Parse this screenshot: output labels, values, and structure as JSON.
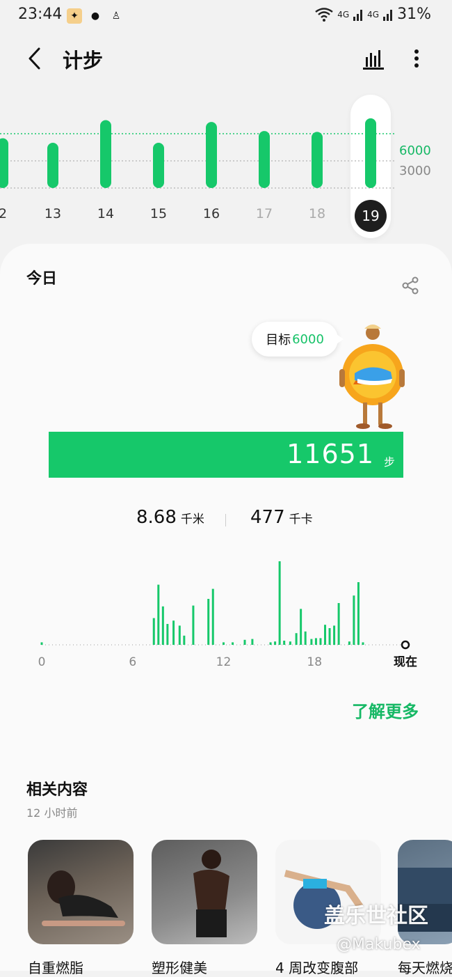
{
  "status_bar": {
    "time": "23:44",
    "signal_labels": [
      "4G",
      "4G"
    ],
    "battery": "31%"
  },
  "header": {
    "title": "计步"
  },
  "week_chart": {
    "goal_label": "6000",
    "mid_label": "3000",
    "colors": {
      "bar": "#16c86a",
      "goal_line": "#16c86a",
      "grid": "#bdbdbd"
    },
    "days": [
      {
        "label": "2",
        "steps": 5500,
        "muted": false
      },
      {
        "label": "13",
        "steps": 5000,
        "muted": false
      },
      {
        "label": "14",
        "steps": 7500,
        "muted": false
      },
      {
        "label": "15",
        "steps": 5000,
        "muted": false
      },
      {
        "label": "16",
        "steps": 7300,
        "muted": false
      },
      {
        "label": "17",
        "steps": 6300,
        "muted": true
      },
      {
        "label": "18",
        "steps": 6200,
        "muted": true
      },
      {
        "label": "19",
        "steps": 7700,
        "muted": false,
        "selected": true
      }
    ]
  },
  "today": {
    "section_title": "今日",
    "goal_prefix": "目标",
    "goal_value": "6000",
    "steps_value": "11651",
    "steps_unit": "步",
    "distance_value": "8.68",
    "distance_unit": "千米",
    "calories_value": "477",
    "calories_unit": "千卡"
  },
  "chart_data": {
    "type": "bar",
    "x_tick_labels": [
      "0",
      "6",
      "12",
      "18",
      "现在"
    ],
    "xlim": [
      0,
      24
    ],
    "ylim": [
      0,
      1000
    ],
    "bars": [
      {
        "x": 0.0,
        "y": 30
      },
      {
        "x": 7.4,
        "y": 320
      },
      {
        "x": 7.7,
        "y": 720
      },
      {
        "x": 8.0,
        "y": 460
      },
      {
        "x": 8.3,
        "y": 250
      },
      {
        "x": 8.7,
        "y": 290
      },
      {
        "x": 9.1,
        "y": 230
      },
      {
        "x": 9.4,
        "y": 110
      },
      {
        "x": 10.0,
        "y": 470
      },
      {
        "x": 11.0,
        "y": 550
      },
      {
        "x": 11.3,
        "y": 670
      },
      {
        "x": 12.0,
        "y": 30
      },
      {
        "x": 12.6,
        "y": 30
      },
      {
        "x": 13.4,
        "y": 60
      },
      {
        "x": 13.9,
        "y": 70
      },
      {
        "x": 15.1,
        "y": 30
      },
      {
        "x": 15.4,
        "y": 40
      },
      {
        "x": 15.7,
        "y": 1000
      },
      {
        "x": 16.0,
        "y": 50
      },
      {
        "x": 16.4,
        "y": 40
      },
      {
        "x": 16.8,
        "y": 140
      },
      {
        "x": 17.1,
        "y": 430
      },
      {
        "x": 17.4,
        "y": 160
      },
      {
        "x": 17.8,
        "y": 70
      },
      {
        "x": 18.1,
        "y": 80
      },
      {
        "x": 18.4,
        "y": 80
      },
      {
        "x": 18.7,
        "y": 240
      },
      {
        "x": 19.0,
        "y": 200
      },
      {
        "x": 19.3,
        "y": 230
      },
      {
        "x": 19.6,
        "y": 500
      },
      {
        "x": 20.3,
        "y": 40
      },
      {
        "x": 20.6,
        "y": 590
      },
      {
        "x": 20.9,
        "y": 750
      },
      {
        "x": 21.2,
        "y": 30
      }
    ]
  },
  "learn_more": "了解更多",
  "related": {
    "title": "相关内容",
    "time": "12 小时前",
    "items": [
      {
        "label": "自重燃脂"
      },
      {
        "label": "塑形健美"
      },
      {
        "label": "4 周改变腹部"
      },
      {
        "label": "每天燃烧"
      }
    ]
  },
  "watermark": {
    "line1": "盖乐世社区",
    "line2": "@Makubex"
  }
}
